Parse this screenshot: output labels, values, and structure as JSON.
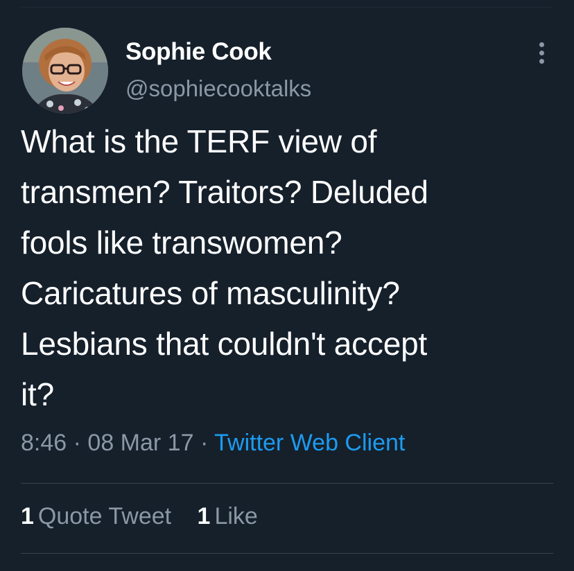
{
  "tweet": {
    "author": {
      "display_name": "Sophie Cook",
      "handle": "@sophiecooktalks",
      "avatar_icon": "profile-photo"
    },
    "more_icon": "more-options-icon",
    "text": "What is the TERF view of\ntransmen? Traitors? Deluded\nfools like transwomen?\nCaricatures of masculinity?\nLesbians that couldn't accept\nit?",
    "time": "8:46",
    "date": "08 Mar 17",
    "separator": "·",
    "source": "Twitter Web Client",
    "stats": {
      "quote_tweets_count": "1",
      "quote_tweets_label": "Quote Tweet",
      "likes_count": "1",
      "likes_label": "Like"
    }
  },
  "colors": {
    "background": "#15202b",
    "text": "#ffffff",
    "secondary": "#8b98a5",
    "link": "#1d9bf0",
    "divider": "#38444d"
  }
}
